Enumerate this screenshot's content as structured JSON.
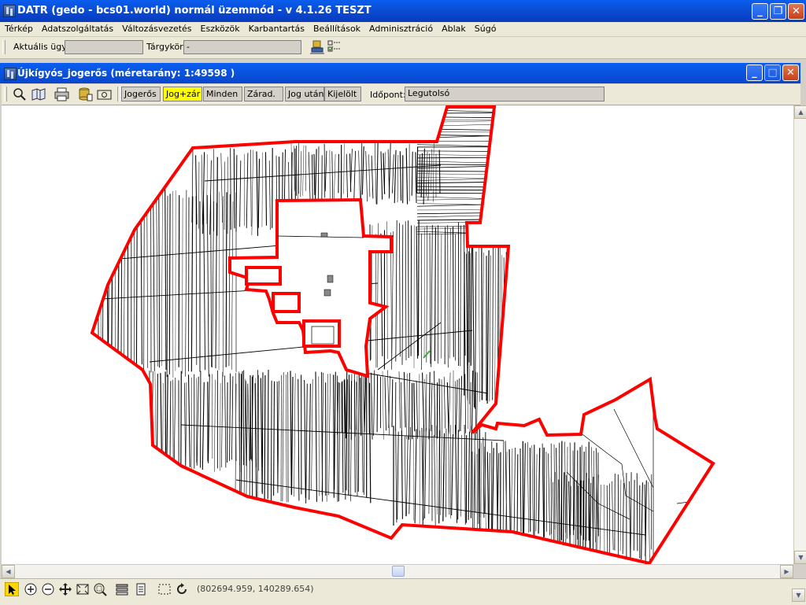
{
  "app": {
    "title": "DATR (gedo - bcs01.world) normál üzemmód - v 4.1.26 TESZT"
  },
  "menu": [
    "Térkép",
    "Adatszolgáltatás",
    "Változásvezetés",
    "Eszközök",
    "Karbantartás",
    "Beállítások",
    "Adminisztráció",
    "Ablak",
    "Súgó"
  ],
  "casebar": {
    "aktualis_label": "Aktuális ügy:",
    "aktualis_value": "",
    "targykor_label": "Tárgykör:",
    "targykor_value": "-"
  },
  "map_window": {
    "title": "Újkígyós_jogerős  (méretarány: 1:49598 )",
    "filters": [
      {
        "label": "Jogerős",
        "active": false
      },
      {
        "label": "Jog+zár",
        "active": true
      },
      {
        "label": "Minden",
        "active": false
      },
      {
        "label": "Zárad.",
        "active": false
      },
      {
        "label": "Jog után",
        "active": false
      },
      {
        "label": "Kijelölt",
        "active": false
      }
    ],
    "idopont_label": "Időpont:",
    "idopont_value": "Legutolsó"
  },
  "statusbar": {
    "coordinates": "(802694.959, 140289.654)"
  },
  "colors": {
    "boundary": "#ff0000",
    "title_bar": "#0a5ef0",
    "active_filter": "#ffff00"
  }
}
